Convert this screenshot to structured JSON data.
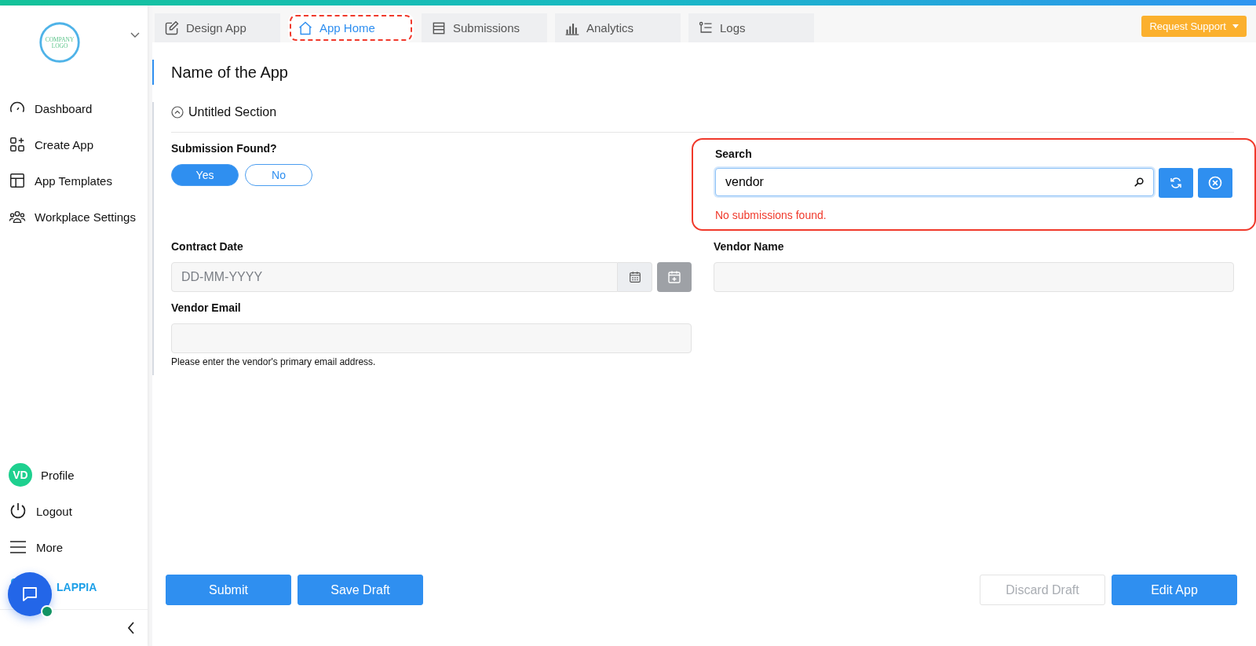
{
  "sidebar": {
    "logo_text": [
      "COMPANY",
      "LOGO"
    ],
    "items": [
      {
        "label": "Dashboard",
        "kind": "dashboard"
      },
      {
        "label": "Create App",
        "kind": "create"
      },
      {
        "label": "App Templates",
        "kind": "templates"
      },
      {
        "label": "Workplace Settings",
        "kind": "team"
      }
    ],
    "profile": {
      "initials": "VD",
      "label": "Profile"
    },
    "bottom_items": [
      {
        "label": "Logout",
        "kind": "power"
      },
      {
        "label": "More",
        "kind": "menu"
      }
    ],
    "brand": "LAPPIA"
  },
  "tabs": [
    {
      "label": "Design App",
      "kind": "edit",
      "selected": false,
      "highlighted": false
    },
    {
      "label": "App Home",
      "kind": "home",
      "selected": true,
      "highlighted": true
    },
    {
      "label": "Submissions",
      "kind": "list",
      "selected": false,
      "highlighted": false
    },
    {
      "label": "Analytics",
      "kind": "chart",
      "selected": false,
      "highlighted": false
    },
    {
      "label": "Logs",
      "kind": "logs",
      "selected": false,
      "highlighted": false
    }
  ],
  "support_button": "Request Support",
  "app_title": "Name of the App",
  "section": {
    "title": "Untitled Section",
    "expanded": true
  },
  "submission_found": {
    "label": "Submission Found?",
    "options": [
      {
        "label": "Yes",
        "selected": true
      },
      {
        "label": "No",
        "selected": false
      }
    ]
  },
  "search": {
    "label": "Search",
    "value": "vendor",
    "error": "No submissions found.",
    "highlighted": true
  },
  "contract_date": {
    "label": "Contract Date",
    "placeholder": "DD-MM-YYYY"
  },
  "vendor_name": {
    "label": "Vendor Name"
  },
  "vendor_email": {
    "label": "Vendor Email",
    "help": "Please enter the vendor's primary email address."
  },
  "buttons_left": [
    {
      "label": "Submit",
      "disabled": false
    },
    {
      "label": "Save Draft",
      "disabled": false
    }
  ],
  "buttons_right": [
    {
      "label": "Discard Draft",
      "disabled": true
    },
    {
      "label": "Edit App",
      "disabled": false
    }
  ]
}
